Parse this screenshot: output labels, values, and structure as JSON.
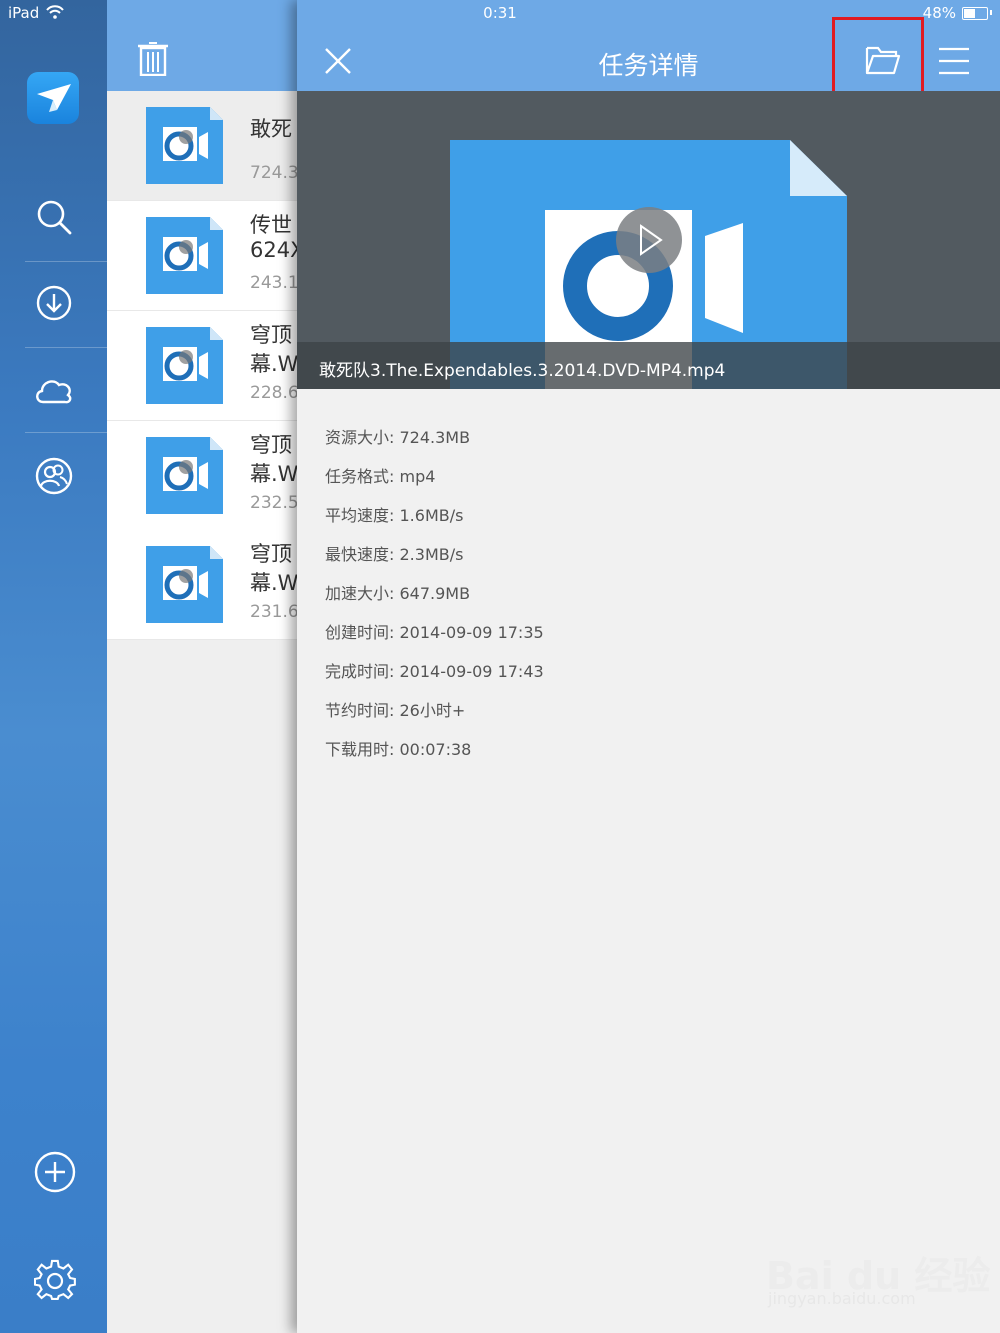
{
  "status_bar": {
    "carrier": "iPad",
    "time": "0:31",
    "battery": "48%",
    "battery_level": 0.48
  },
  "sidebar": {
    "icons": [
      "app-logo-icon",
      "search-icon",
      "download-icon",
      "cloud-icon",
      "friends-icon",
      "add-icon",
      "settings-icon"
    ]
  },
  "list": {
    "items": [
      {
        "line1": "敢死",
        "line2": "",
        "meta": "724.3"
      },
      {
        "line1": "传世",
        "line2": "624X",
        "meta": "243.1"
      },
      {
        "line1": "穹顶",
        "line2": "幕.W",
        "meta": "228.6"
      },
      {
        "line1": "穹顶",
        "line2": "幕.W",
        "meta": "232.5"
      },
      {
        "line1": "穹顶",
        "line2": "幕.W",
        "meta": "231.6"
      }
    ]
  },
  "panel": {
    "title": "任务详情",
    "file_name": "敢死队3.The.Expendables.3.2014.DVD-MP4.mp4",
    "details": [
      {
        "label": "资源大小:",
        "value": "724.3MB"
      },
      {
        "label": "任务格式:",
        "value": "mp4"
      },
      {
        "label": "平均速度:",
        "value": "1.6MB/s"
      },
      {
        "label": "最快速度:",
        "value": "2.3MB/s"
      },
      {
        "label": "加速大小:",
        "value": "647.9MB"
      },
      {
        "label": "创建时间:",
        "value": "2014-09-09 17:35"
      },
      {
        "label": "完成时间:",
        "value": "2014-09-09 17:43"
      },
      {
        "label": "节约时间:",
        "value": "26小时+"
      },
      {
        "label": "下载用时:",
        "value": "00:07:38"
      }
    ]
  },
  "watermark": {
    "line1": "Bai du 经验",
    "line2": "jingyan.baidu.com"
  },
  "colors": {
    "header_blue": "#6ea9e6",
    "file_blue": "#3f9fe8",
    "highlight_red": "#e11b22"
  }
}
